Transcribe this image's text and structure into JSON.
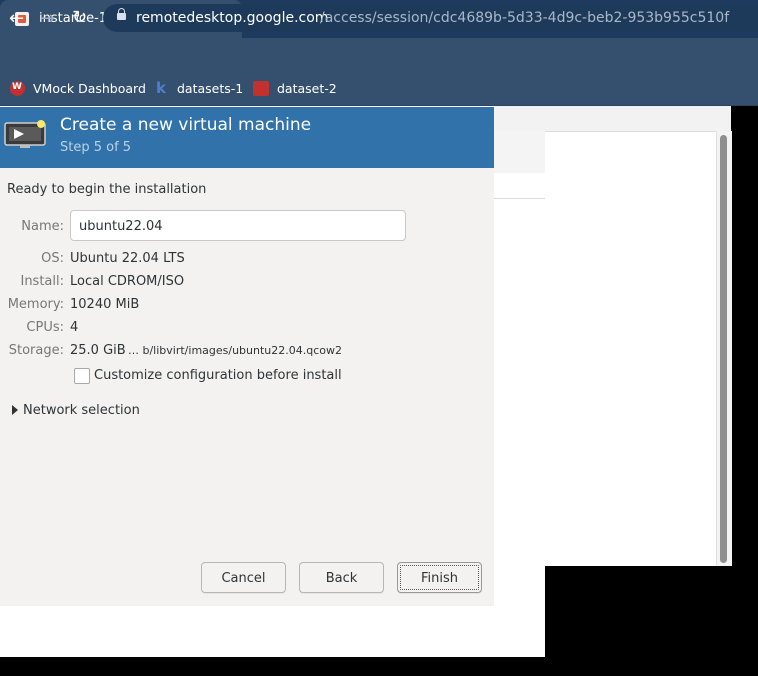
{
  "browser": {
    "tab_title": "instance-1",
    "tab_close": "✕",
    "new_tab": "+",
    "url_host": "remotedesktop.google.com",
    "url_path": "/access/session/cdc4689b-5d33-4d9c-beb2-953b955c510f",
    "bookmarks": [
      "VMock Dashboard",
      "datasets-1",
      "dataset-2"
    ]
  },
  "dialog": {
    "title": "Create a new virtual machine",
    "step": "Step 5 of 5",
    "ready_text": "Ready to begin the installation",
    "fields": {
      "name_label": "Name:",
      "name_value": "ubuntu22.04",
      "os_label": "OS:",
      "os_value": "Ubuntu 22.04 LTS",
      "install_label": "Install:",
      "install_value": "Local CDROM/ISO",
      "memory_label": "Memory:",
      "memory_value": "10240 MiB",
      "cpus_label": "CPUs:",
      "cpus_value": "4",
      "storage_label": "Storage:",
      "storage_value": "25.0 GiB",
      "storage_path": "… b/libvirt/images/ubuntu22.04.qcow2"
    },
    "customize_label": "Customize configuration before install",
    "customize_checked": false,
    "network_label": "Network selection",
    "buttons": {
      "cancel": "Cancel",
      "back": "Back",
      "finish": "Finish"
    }
  },
  "colors": {
    "header_blue": "#3072a9",
    "chrome_dark": "#1f3a5f",
    "chrome": "#35506f"
  }
}
